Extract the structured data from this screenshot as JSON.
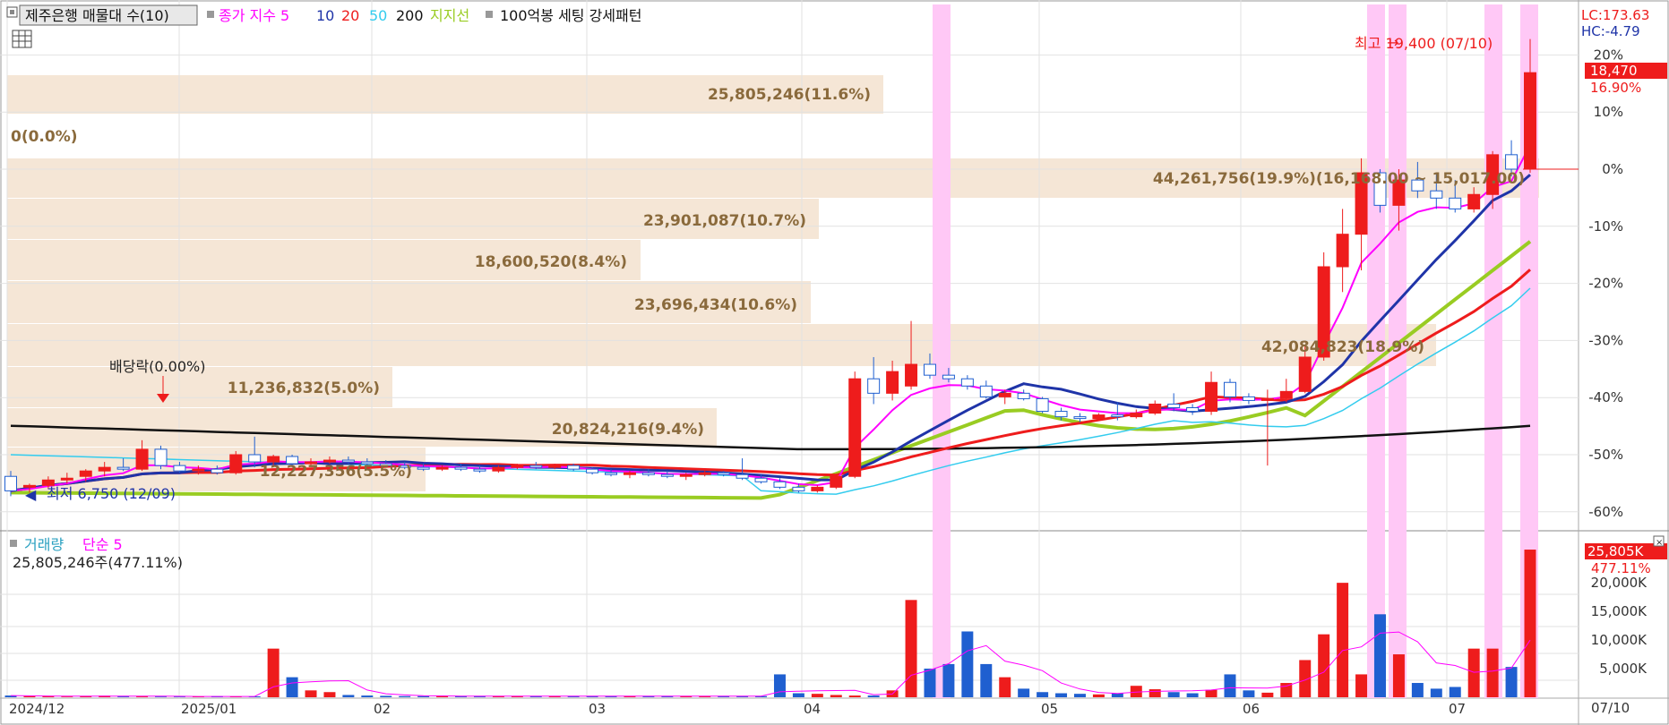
{
  "price_panel": {
    "indicator_label": "제주은행 매물대 수(10)",
    "ma_title": "종가 지수 5",
    "ma_periods": [
      "10",
      "20",
      "50",
      "200"
    ],
    "ma_colors": {
      "5": "#ff00ff",
      "10": "#1f34a8",
      "20": "#ee1c1c",
      "50": "#33ccee",
      "200": "#111111",
      "support": "#99cc22"
    },
    "support_label": "지지선",
    "pattern_label": "100억봉 세팅 강세패턴",
    "lc": "LC:173.63",
    "hc": "HC:-4.79",
    "high_label": "최고 19,400 (07/10)",
    "low_label": "최저 6,750 (12/09)",
    "dividend_label": "배당락(0.00%)",
    "current_price": "18,470",
    "current_change": "16.90%",
    "pct_ticks": [
      "20%",
      "10%",
      "0%",
      "-10%",
      "-20%",
      "-30%",
      "-40%",
      "-50%",
      "-60%"
    ]
  },
  "volume_panel": {
    "title": "거래량",
    "ma_label": "단순 5",
    "summary": "25,805,246주(477.11%)",
    "current_volume": "25,805K",
    "current_ratio": "477.11%",
    "ticks": [
      "20,000K",
      "15,000K",
      "10,000K",
      "5,000K"
    ]
  },
  "x_axis": {
    "labels": [
      "2024/12",
      "2025/01",
      "02",
      "03",
      "04",
      "05",
      "06",
      "07"
    ],
    "end_label": "07/10"
  },
  "chart_data": {
    "type": "candlestick",
    "price_range": [
      6000,
      19400
    ],
    "pct_ticks": [
      20,
      10,
      0,
      -10,
      -20,
      -30,
      -40,
      -50,
      -60
    ],
    "volume_profile": [
      {
        "label": "25,805,246(11.6%)",
        "volume": 25805246,
        "pct": 11.6
      },
      {
        "label": "0(0.0%)",
        "volume": 0,
        "pct": 0.0
      },
      {
        "label": "44,261,756(19.9%)(16,168.00 ~ 15,017.00)",
        "volume": 44261756,
        "pct": 19.9
      },
      {
        "label": "23,901,087(10.7%)",
        "volume": 23901087,
        "pct": 10.7
      },
      {
        "label": "18,600,520(8.4%)",
        "volume": 18600520,
        "pct": 8.4
      },
      {
        "label": "23,696,434(10.6%)",
        "volume": 23696434,
        "pct": 10.6
      },
      {
        "label": "42,084,823(18.9%)",
        "volume": 42084823,
        "pct": 18.9
      },
      {
        "label": "11,236,832(5.0%)",
        "volume": 11236832,
        "pct": 5.0
      },
      {
        "label": "20,824,216(9.4%)",
        "volume": 20824216,
        "pct": 9.4
      },
      {
        "label": "12,227,356(5.5%)",
        "volume": 12227356,
        "pct": 5.5
      }
    ],
    "candles": [
      {
        "o": 7300,
        "h": 7450,
        "l": 6750,
        "c": 6900
      },
      {
        "o": 7000,
        "h": 7100,
        "l": 6850,
        "c": 7050
      },
      {
        "o": 7050,
        "h": 7300,
        "l": 6950,
        "c": 7200
      },
      {
        "o": 7200,
        "h": 7400,
        "l": 7100,
        "c": 7250
      },
      {
        "o": 7300,
        "h": 7500,
        "l": 7150,
        "c": 7450
      },
      {
        "o": 7450,
        "h": 7700,
        "l": 7300,
        "c": 7550
      },
      {
        "o": 7550,
        "h": 7800,
        "l": 7450,
        "c": 7500
      },
      {
        "o": 7500,
        "h": 8300,
        "l": 7450,
        "c": 8050
      },
      {
        "o": 8050,
        "h": 8150,
        "l": 7500,
        "c": 7600
      },
      {
        "o": 7600,
        "h": 7700,
        "l": 7400,
        "c": 7450
      },
      {
        "o": 7450,
        "h": 7600,
        "l": 7350,
        "c": 7500
      },
      {
        "o": 7500,
        "h": 7600,
        "l": 7350,
        "c": 7400
      },
      {
        "o": 7400,
        "h": 8000,
        "l": 7350,
        "c": 7900
      },
      {
        "o": 7900,
        "h": 8400,
        "l": 7550,
        "c": 7700
      },
      {
        "o": 7700,
        "h": 7900,
        "l": 7550,
        "c": 7850
      },
      {
        "o": 7850,
        "h": 7900,
        "l": 7600,
        "c": 7650
      },
      {
        "o": 7650,
        "h": 7800,
        "l": 7600,
        "c": 7700
      },
      {
        "o": 7700,
        "h": 7850,
        "l": 7650,
        "c": 7750
      },
      {
        "o": 7750,
        "h": 7850,
        "l": 7650,
        "c": 7700
      },
      {
        "o": 7700,
        "h": 7800,
        "l": 7600,
        "c": 7650
      },
      {
        "o": 7650,
        "h": 7750,
        "l": 7550,
        "c": 7600
      },
      {
        "o": 7600,
        "h": 7700,
        "l": 7500,
        "c": 7550
      },
      {
        "o": 7550,
        "h": 7650,
        "l": 7450,
        "c": 7500
      },
      {
        "o": 7500,
        "h": 7600,
        "l": 7450,
        "c": 7550
      },
      {
        "o": 7550,
        "h": 7650,
        "l": 7450,
        "c": 7500
      },
      {
        "o": 7500,
        "h": 7600,
        "l": 7400,
        "c": 7450
      },
      {
        "o": 7450,
        "h": 7600,
        "l": 7400,
        "c": 7550
      },
      {
        "o": 7550,
        "h": 7650,
        "l": 7500,
        "c": 7600
      },
      {
        "o": 7600,
        "h": 7700,
        "l": 7500,
        "c": 7550
      },
      {
        "o": 7550,
        "h": 7650,
        "l": 7500,
        "c": 7600
      },
      {
        "o": 7600,
        "h": 7650,
        "l": 7450,
        "c": 7500
      },
      {
        "o": 7500,
        "h": 7550,
        "l": 7350,
        "c": 7400
      },
      {
        "o": 7400,
        "h": 7500,
        "l": 7300,
        "c": 7350
      },
      {
        "o": 7350,
        "h": 7450,
        "l": 7250,
        "c": 7400
      },
      {
        "o": 7400,
        "h": 7500,
        "l": 7300,
        "c": 7350
      },
      {
        "o": 7350,
        "h": 7450,
        "l": 7250,
        "c": 7300
      },
      {
        "o": 7300,
        "h": 7400,
        "l": 7200,
        "c": 7350
      },
      {
        "o": 7350,
        "h": 7450,
        "l": 7300,
        "c": 7400
      },
      {
        "o": 7400,
        "h": 7450,
        "l": 7300,
        "c": 7350
      },
      {
        "o": 7350,
        "h": 7800,
        "l": 7200,
        "c": 7250
      },
      {
        "o": 7250,
        "h": 7350,
        "l": 7100,
        "c": 7150
      },
      {
        "o": 7150,
        "h": 7250,
        "l": 6950,
        "c": 7000
      },
      {
        "o": 7000,
        "h": 7100,
        "l": 6850,
        "c": 6900
      },
      {
        "o": 6900,
        "h": 7050,
        "l": 6850,
        "c": 7000
      },
      {
        "o": 7000,
        "h": 7350,
        "l": 6950,
        "c": 7300
      },
      {
        "o": 7300,
        "h": 10200,
        "l": 7250,
        "c": 10000
      },
      {
        "o": 10000,
        "h": 10600,
        "l": 9300,
        "c": 9600
      },
      {
        "o": 9600,
        "h": 10500,
        "l": 9400,
        "c": 10200
      },
      {
        "o": 9800,
        "h": 11600,
        "l": 9700,
        "c": 10400
      },
      {
        "o": 10400,
        "h": 10700,
        "l": 10000,
        "c": 10100
      },
      {
        "o": 10100,
        "h": 10300,
        "l": 9900,
        "c": 10000
      },
      {
        "o": 10000,
        "h": 10100,
        "l": 9700,
        "c": 9800
      },
      {
        "o": 9800,
        "h": 9950,
        "l": 9450,
        "c": 9500
      },
      {
        "o": 9500,
        "h": 9700,
        "l": 9300,
        "c": 9600
      },
      {
        "o": 9600,
        "h": 9700,
        "l": 9400,
        "c": 9450
      },
      {
        "o": 9450,
        "h": 9500,
        "l": 9050,
        "c": 9100
      },
      {
        "o": 9100,
        "h": 9200,
        "l": 8850,
        "c": 8950
      },
      {
        "o": 8950,
        "h": 9050,
        "l": 8800,
        "c": 8900
      },
      {
        "o": 8900,
        "h": 9050,
        "l": 8850,
        "c": 9000
      },
      {
        "o": 9000,
        "h": 9350,
        "l": 8850,
        "c": 8950
      },
      {
        "o": 8950,
        "h": 9150,
        "l": 8900,
        "c": 9050
      },
      {
        "o": 9050,
        "h": 9400,
        "l": 9000,
        "c": 9300
      },
      {
        "o": 9300,
        "h": 9600,
        "l": 9100,
        "c": 9200
      },
      {
        "o": 9200,
        "h": 9300,
        "l": 9000,
        "c": 9100
      },
      {
        "o": 9100,
        "h": 10200,
        "l": 9000,
        "c": 9900
      },
      {
        "o": 9900,
        "h": 10000,
        "l": 9350,
        "c": 9500
      },
      {
        "o": 9500,
        "h": 9600,
        "l": 9300,
        "c": 9400
      },
      {
        "o": 9400,
        "h": 9700,
        "l": 7600,
        "c": 9450
      },
      {
        "o": 9450,
        "h": 10000,
        "l": 9350,
        "c": 9650
      },
      {
        "o": 9650,
        "h": 10900,
        "l": 9600,
        "c": 10600
      },
      {
        "o": 10600,
        "h": 13500,
        "l": 10500,
        "c": 13100
      },
      {
        "o": 13100,
        "h": 14700,
        "l": 12400,
        "c": 14000
      },
      {
        "o": 14000,
        "h": 16100,
        "l": 13000,
        "c": 15700
      },
      {
        "o": 15700,
        "h": 15800,
        "l": 14600,
        "c": 14800
      },
      {
        "o": 14800,
        "h": 15800,
        "l": 14100,
        "c": 15500
      },
      {
        "o": 15500,
        "h": 16000,
        "l": 15000,
        "c": 15200
      },
      {
        "o": 15200,
        "h": 15700,
        "l": 14700,
        "c": 15000
      },
      {
        "o": 15000,
        "h": 15500,
        "l": 14600,
        "c": 14700
      },
      {
        "o": 14700,
        "h": 15300,
        "l": 14600,
        "c": 15100
      },
      {
        "o": 15100,
        "h": 16300,
        "l": 14700,
        "c": 16200
      },
      {
        "o": 16200,
        "h": 16600,
        "l": 15600,
        "c": 15800
      },
      {
        "o": 15800,
        "h": 19400,
        "l": 15700,
        "c": 18470
      }
    ],
    "volume_thousands": [
      300,
      200,
      150,
      120,
      200,
      280,
      200,
      150,
      130,
      120,
      110,
      200,
      150,
      150,
      8500,
      3500,
      1200,
      900,
      400,
      300,
      250,
      200,
      200,
      200,
      200,
      200,
      200,
      200,
      200,
      200,
      200,
      200,
      200,
      200,
      200,
      200,
      200,
      200,
      200,
      200,
      200,
      4000,
      700,
      600,
      400,
      300,
      300,
      1200,
      17000,
      5000,
      5800,
      11500,
      5800,
      3500,
      1500,
      900,
      700,
      600,
      500,
      700,
      2000,
      1400,
      900,
      700,
      1300,
      4000,
      1200,
      800,
      2500,
      6500,
      11000,
      20000,
      4000,
      14500,
      7500,
      2500,
      1500,
      1800,
      8500,
      8500,
      5300,
      25805
    ]
  }
}
